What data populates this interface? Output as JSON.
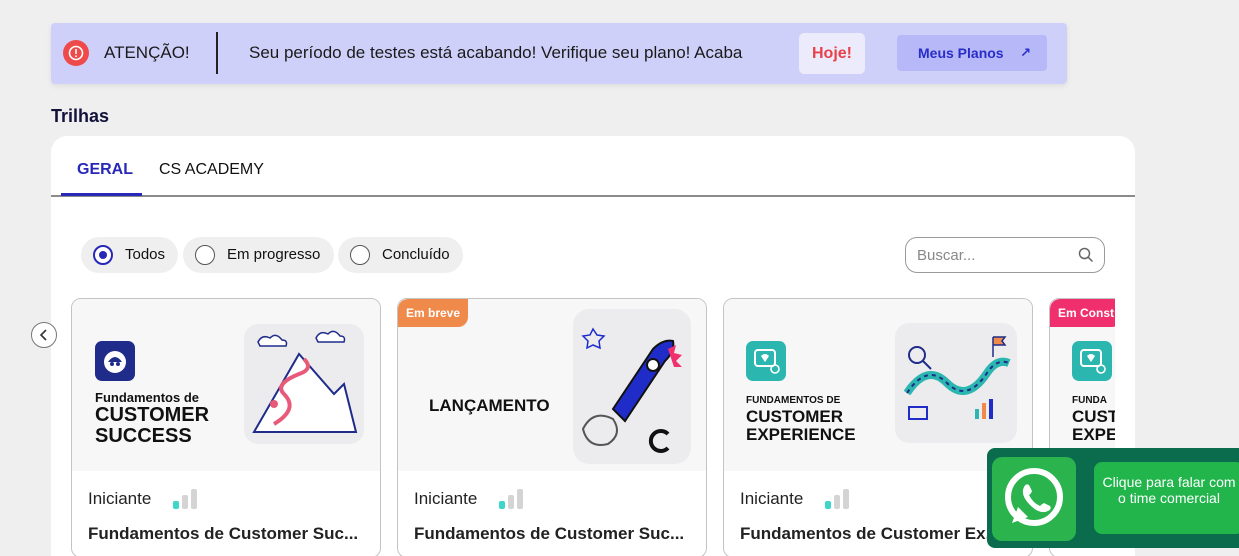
{
  "banner": {
    "attention": "ATENÇÃO!",
    "message": "Seu período de testes está acabando! Verifique seu plano! Acaba",
    "deadline": "Hoje!",
    "plans_button": "Meus Planos",
    "plans_arrow": "↗"
  },
  "section_title": "Trilhas",
  "tabs": [
    {
      "label": "GERAL",
      "active": true
    },
    {
      "label": "CS ACADEMY",
      "active": false
    }
  ],
  "filters": [
    {
      "label": "Todos",
      "selected": true
    },
    {
      "label": "Em progresso",
      "selected": false
    },
    {
      "label": "Concluído",
      "selected": false
    }
  ],
  "search": {
    "placeholder": "Buscar..."
  },
  "cards": [
    {
      "badge": "",
      "thumb_lines": [
        "Fundamentos de",
        "CUSTOMER",
        "SUCCESS"
      ],
      "level": "Iniciante",
      "title": "Fundamentos de Customer Suc..."
    },
    {
      "badge": "Em breve",
      "thumb_lines": [
        "LANÇAMENTO"
      ],
      "level": "Iniciante",
      "title": "Fundamentos de Customer Suc..."
    },
    {
      "badge": "",
      "thumb_lines": [
        "FUNDAMENTOS DE",
        "CUSTOMER",
        "EXPERIENCE"
      ],
      "level": "Iniciante",
      "title": "Fundamentos de Customer Ex..."
    },
    {
      "badge": "Em Const",
      "thumb_lines": [
        "FUNDA",
        "CUST",
        "EXPE"
      ],
      "level": "",
      "title": ""
    }
  ],
  "whatsapp": {
    "text": "Clique para falar com o time comercial"
  },
  "colors": {
    "accent": "#2828b8",
    "banner_bg": "#cfd0fa",
    "alert": "#ef4a4a",
    "badge_soon": "#f08a4b",
    "badge_construction": "#f0306e",
    "level_bar": "#3dd6c8",
    "whatsapp": "#2bb34e"
  }
}
